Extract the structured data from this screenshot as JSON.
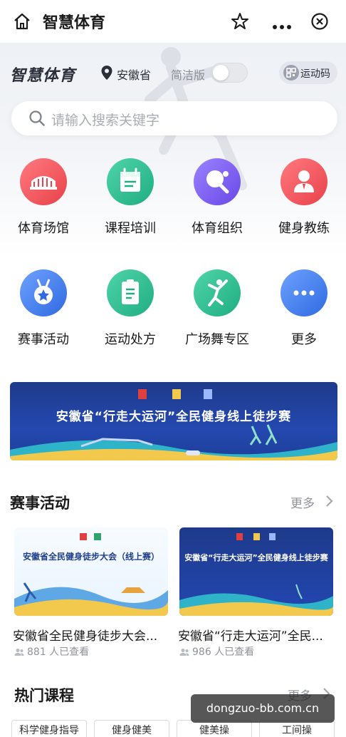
{
  "topbar": {
    "title": "智慧体育"
  },
  "header": {
    "brand": "智慧体育",
    "province": "安徽省",
    "simple_mode_label": "简洁版",
    "simple_mode_on": false,
    "sport_code_label": "运动码"
  },
  "search": {
    "placeholder": "请输入搜索关键字"
  },
  "grid": [
    {
      "label": "体育场馆",
      "icon": "stadium-icon",
      "color": "#f0535a"
    },
    {
      "label": "课程培训",
      "icon": "calendar-icon",
      "color": "#27b98d"
    },
    {
      "label": "体育组织",
      "icon": "ping-pong-icon",
      "color": "#7a5cf0"
    },
    {
      "label": "健身教练",
      "icon": "coach-icon",
      "color": "#f0535a"
    },
    {
      "label": "赛事活动",
      "icon": "medal-icon",
      "color": "#3f7bea"
    },
    {
      "label": "运动处方",
      "icon": "prescription-icon",
      "color": "#27b98d"
    },
    {
      "label": "广场舞专区",
      "icon": "dancer-icon",
      "color": "#27b98d"
    },
    {
      "label": "更多",
      "icon": "more-dots-icon",
      "color": "#3f7bea"
    }
  ],
  "banner": {
    "text": "安徽省“行走大运河”全民健身线上徒步赛"
  },
  "events": {
    "title": "赛事活动",
    "more_label": "更多",
    "cards": [
      {
        "thumb_title": "安徽省全民健身徒步大会（线上赛）",
        "title": "安徽省全民健身徒步大会...",
        "views": "881 人已查看"
      },
      {
        "thumb_title": "安徽省“行走大运河”全民健身线上徒步赛",
        "title": "安徽省“行走大运河”全民...",
        "views": "986 人已查看"
      }
    ]
  },
  "courses": {
    "title": "热门课程",
    "more_label": "更多",
    "chips": [
      "科学健身指导",
      "健身健美",
      "健美操",
      "工间操"
    ]
  },
  "watermark": "dongzuo-bb.com.cn"
}
